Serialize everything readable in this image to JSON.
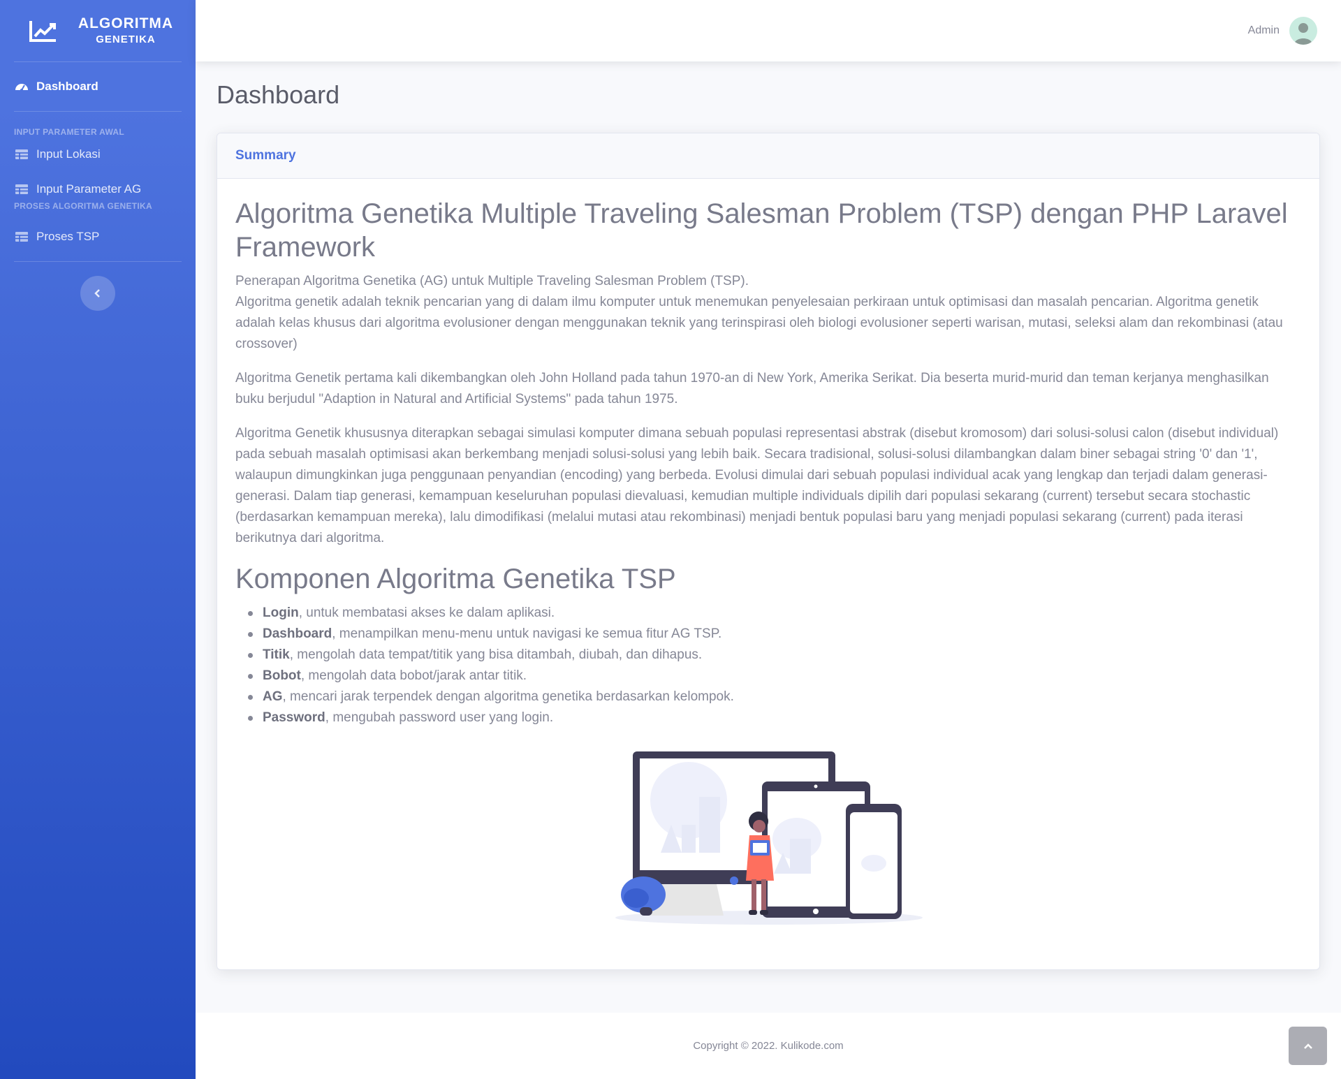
{
  "brand": {
    "line1": "ALGORITMA",
    "line2": "GENETIKA",
    "icon": "chart-line-icon"
  },
  "sidebar": {
    "dashboard": "Dashboard",
    "heading1": "INPUT PARAMETER AWAL",
    "input_lokasi": "Input Lokasi",
    "input_parameter": "Input Parameter AG",
    "heading2": "PROSES ALGORITMA GENETIKA",
    "proses_tsp": "Proses TSP"
  },
  "topbar": {
    "user": "Admin"
  },
  "page": {
    "title": "Dashboard"
  },
  "card": {
    "header": "Summary",
    "title": "Algoritma Genetika Multiple Traveling Salesman Problem (TSP) dengan PHP Laravel Framework",
    "intro": "Penerapan Algoritma Genetika (AG) untuk Multiple Traveling Salesman Problem (TSP).",
    "p1": "Algoritma genetik adalah teknik pencarian yang di dalam ilmu komputer untuk menemukan penyelesaian perkiraan untuk optimisasi dan masalah pencarian. Algoritma genetik adalah kelas khusus dari algoritma evolusioner dengan menggunakan teknik yang terinspirasi oleh biologi evolusioner seperti warisan, mutasi, seleksi alam dan rekombinasi (atau crossover)",
    "p2": "Algoritma Genetik pertama kali dikembangkan oleh John Holland pada tahun 1970-an di New York, Amerika Serikat. Dia beserta murid-murid dan teman kerjanya menghasilkan buku berjudul \"Adaption in Natural and Artificial Systems\" pada tahun 1975.",
    "p3": "Algoritma Genetik khususnya diterapkan sebagai simulasi komputer dimana sebuah populasi representasi abstrak (disebut kromosom) dari solusi-solusi calon (disebut individual) pada sebuah masalah optimisasi akan berkembang menjadi solusi-solusi yang lebih baik. Secara tradisional, solusi-solusi dilambangkan dalam biner sebagai string '0' dan '1', walaupun dimungkinkan juga penggunaan penyandian (encoding) yang berbeda. Evolusi dimulai dari sebuah populasi individual acak yang lengkap dan terjadi dalam generasi-generasi. Dalam tiap generasi, kemampuan keseluruhan populasi dievaluasi, kemudian multiple individuals dipilih dari populasi sekarang (current) tersebut secara stochastic (berdasarkan kemampuan mereka), lalu dimodifikasi (melalui mutasi atau rekombinasi) menjadi bentuk populasi baru yang menjadi populasi sekarang (current) pada iterasi berikutnya dari algoritma.",
    "subtitle": "Komponen Algoritma Genetika TSP",
    "components": [
      {
        "name": "Login",
        "desc": ", untuk membatasi akses ke dalam aplikasi."
      },
      {
        "name": "Dashboard",
        "desc": ", menampilkan menu-menu untuk navigasi ke semua fitur AG TSP."
      },
      {
        "name": "Titik",
        "desc": ", mengolah data tempat/titik yang bisa ditambah, diubah, dan dihapus."
      },
      {
        "name": "Bobot",
        "desc": ", mengolah data bobot/jarak antar titik."
      },
      {
        "name": "AG",
        "desc": ", mencari jarak terpendek dengan algoritma genetika berdasarkan kelompok."
      },
      {
        "name": "Password",
        "desc": ", mengubah password user yang login."
      }
    ]
  },
  "footer": {
    "copyright": "Copyright © 2022. Kulikode.com"
  },
  "colors": {
    "primary": "#4e73df",
    "primary_dark": "#224abe",
    "text": "#858796",
    "accent": "#fe6f5e"
  }
}
